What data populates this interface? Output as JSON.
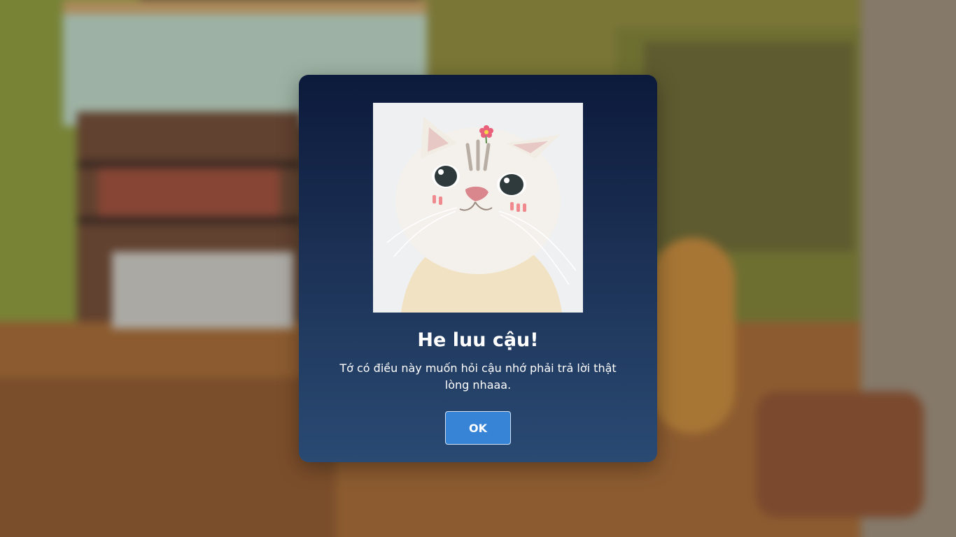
{
  "dialog": {
    "image": {
      "icon": "cat-with-flower-image"
    },
    "title": "He luu cậu!",
    "message": "Tớ có điều này muốn hỏi cậu nhớ phải trả lời thật lòng nhaaa.",
    "ok_label": "OK"
  },
  "colors": {
    "dialog_top": "#0c1a3b",
    "dialog_bottom": "#2a4a73",
    "button": "#3784d7",
    "text": "#ffffff"
  }
}
